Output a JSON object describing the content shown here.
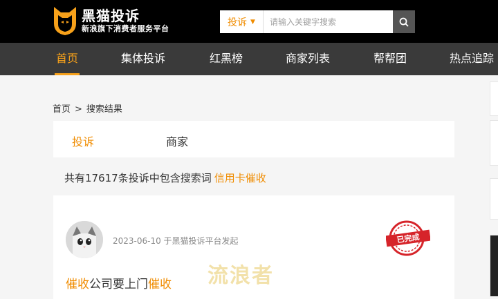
{
  "header": {
    "logo_title": "黑猫投诉",
    "logo_subtitle": "新浪旗下消费者服务平台",
    "search": {
      "type_label": "投诉",
      "placeholder": "请输入关键字搜索"
    }
  },
  "nav": {
    "items": [
      {
        "label": "首页"
      },
      {
        "label": "集体投诉"
      },
      {
        "label": "红黑榜"
      },
      {
        "label": "商家列表"
      },
      {
        "label": "帮帮团"
      },
      {
        "label": "热点追踪"
      }
    ]
  },
  "breadcrumb": {
    "home": "首页",
    "separator": ">",
    "current": "搜索结果"
  },
  "tabs": {
    "complaint": "投诉",
    "merchant": "商家"
  },
  "results": {
    "summary_prefix": "共有17617条投诉中包含搜索词",
    "keyword": "信用卡催收"
  },
  "item": {
    "meta": "2023-06-10 于黑猫投诉平台发起",
    "status": "已完成",
    "title_hl_1": "催收",
    "title_mid": "公司要上门",
    "title_hl_2": "催收"
  },
  "watermark": "流浪者",
  "colors": {
    "accent": "#f08c00",
    "nav_bg": "#3a3a3a",
    "stamp_red": "#d6242a"
  }
}
